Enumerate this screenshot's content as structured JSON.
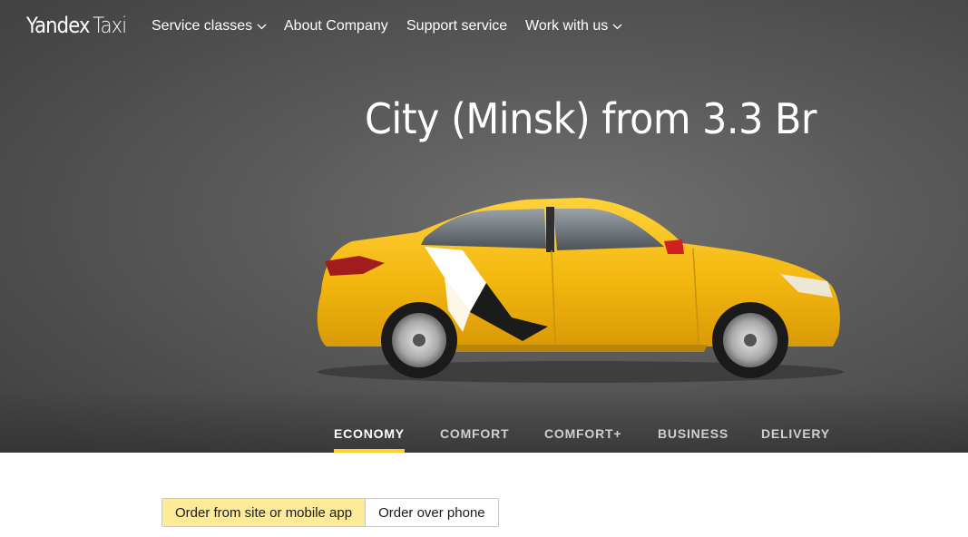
{
  "header": {
    "logo_brand": "Yandex",
    "logo_product": "Taxi",
    "nav": [
      {
        "label": "Service classes",
        "has_dropdown": true
      },
      {
        "label": "About Company",
        "has_dropdown": false
      },
      {
        "label": "Support service",
        "has_dropdown": false
      },
      {
        "label": "Work with us",
        "has_dropdown": true
      }
    ]
  },
  "hero": {
    "headline": "City (Minsk) from 3.3 Br",
    "image": "yellow-taxi-sedan"
  },
  "tariff_tabs": [
    {
      "label": "ECONOMY",
      "active": true
    },
    {
      "label": "COMFORT",
      "active": false
    },
    {
      "label": "COMFORT+",
      "active": false
    },
    {
      "label": "BUSINESS",
      "active": false
    },
    {
      "label": "DELIVERY",
      "active": false
    }
  ],
  "order_options": [
    {
      "label": "Order from site or mobile app",
      "active": true
    },
    {
      "label": "Order over phone",
      "active": false
    }
  ],
  "colors": {
    "accent_yellow": "#fcd02f",
    "selected_segment": "#fdeb99",
    "hero_background": "#5a5a5a"
  }
}
